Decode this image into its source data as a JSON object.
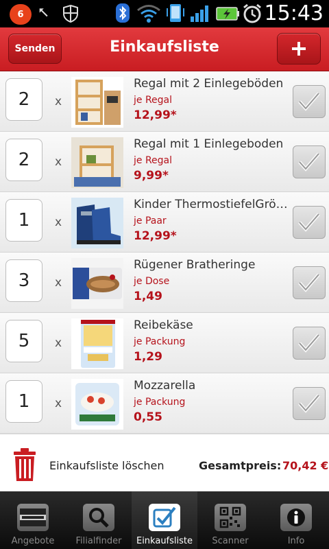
{
  "statusbar": {
    "notification_count": "6",
    "time": "15:43"
  },
  "header": {
    "title": "Einkaufsliste",
    "send_label": "Senden",
    "add_label": "+"
  },
  "items": [
    {
      "qty": "2",
      "times": "x",
      "name": "Regal mit 2 Einlegeböden",
      "unit": "je Regal",
      "price": "12,99*"
    },
    {
      "qty": "2",
      "times": "x",
      "name": "Regal mit 1 Einlegeboden",
      "unit": "je Regal",
      "price": "9,99*"
    },
    {
      "qty": "1",
      "times": "x",
      "name": "Kinder ThermostiefelGröß…",
      "unit": "je Paar",
      "price": "12,99*"
    },
    {
      "qty": "3",
      "times": "x",
      "name": "Rügener Bratheringe",
      "unit": "je Dose",
      "price": "1,49"
    },
    {
      "qty": "5",
      "times": "x",
      "name": "Reibekäse",
      "unit": "je Packung",
      "price": "1,29"
    },
    {
      "qty": "1",
      "times": "x",
      "name": "Mozzarella",
      "unit": "je Packung",
      "price": "0,55"
    }
  ],
  "footer": {
    "clear_label": "Einkaufsliste löschen",
    "total_label": "Gesamtpreis:",
    "total_value": "70,42 €"
  },
  "tabs": [
    {
      "label": "Angebote",
      "icon": "norma-logo-icon"
    },
    {
      "label": "Filialfinder",
      "icon": "search-icon"
    },
    {
      "label": "Einkaufsliste",
      "icon": "checklist-icon"
    },
    {
      "label": "Scanner",
      "icon": "qr-code-icon"
    },
    {
      "label": "Info",
      "icon": "info-icon"
    }
  ],
  "active_tab": "Einkaufsliste",
  "colors": {
    "brand_red": "#c91d22",
    "price_red": "#b5121b"
  }
}
